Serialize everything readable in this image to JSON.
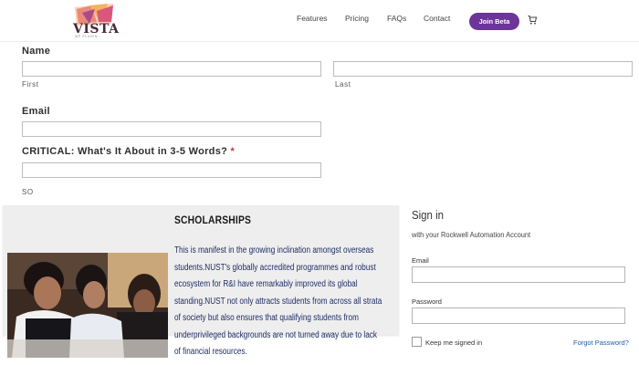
{
  "header": {
    "logo_text": "VISTA",
    "logo_tagline": "WP PLUGIN",
    "nav": [
      "Features",
      "Pricing",
      "FAQs",
      "Contact"
    ],
    "join_label": "Join Beta",
    "cart_icon": "cart-icon"
  },
  "form": {
    "name_label": "Name",
    "first_label": "First",
    "last_label": "Last",
    "first_value": "",
    "last_value": "",
    "email_label": "Email",
    "email_value": "",
    "about_label": "CRITICAL: What's It About in 3-5 Words?",
    "about_required": "*",
    "about_value": "",
    "so_text": "SO"
  },
  "scholarship": {
    "title": "SCHOLARSHIPS",
    "body": "This is manifest in the growing inclination amongst overseas students.NUST's globally accredited programmes and robust ecosystem for R&I have remarkably improved its global standing.NUST not only attracts students from across all strata of society but also ensures that qualifying students from underprivileged backgrounds are not turned away due to lack of financial resources."
  },
  "signin": {
    "title": "Sign in",
    "subtitle": "with your Rockwell Automation Account",
    "email_label": "Email",
    "email_value": "",
    "password_label": "Password",
    "password_value": "",
    "keep_label": "Keep me signed in",
    "keep_checked": false,
    "forgot_label": "Forgot Password?"
  },
  "colors": {
    "accent": "#6d3598",
    "link": "#1c5fa8",
    "body_text": "#1e2c64",
    "card_bg": "#eeeeee"
  }
}
